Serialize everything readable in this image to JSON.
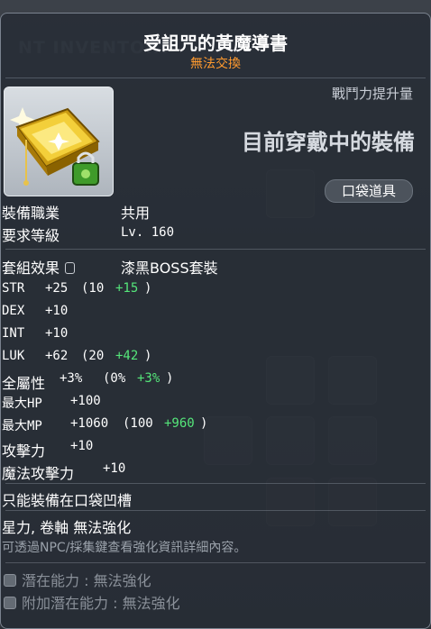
{
  "item": {
    "name": "受詛咒的黃魔導書",
    "trade_status": "無法交換"
  },
  "header": {
    "power_label": "戰鬥力提升量",
    "equipped_text": "目前穿戴中的裝備",
    "pocket_badge": "口袋道具"
  },
  "info": {
    "job_label": "裝備職業",
    "job_value": "共用",
    "level_label": "要求等級",
    "level_value": "Lv. 160",
    "set_label": "套組效果",
    "set_value": "漆黑BOSS套裝"
  },
  "stats": [
    {
      "name": "STR",
      "total": "+25",
      "base": "(10",
      "bonus": "+15",
      "close": ")"
    },
    {
      "name": "DEX",
      "total": "+10",
      "base": "",
      "bonus": "",
      "close": ""
    },
    {
      "name": "INT",
      "total": "+10",
      "base": "",
      "bonus": "",
      "close": ""
    },
    {
      "name": "LUK",
      "total": "+62",
      "base": "(20",
      "bonus": "+42",
      "close": ")"
    },
    {
      "name": "全屬性",
      "total": "+3%",
      "base": "(0%",
      "bonus": "+3%",
      "close": ")"
    },
    {
      "name": "最大HP",
      "total": "+100",
      "base": "",
      "bonus": "",
      "close": ""
    },
    {
      "name": "最大MP",
      "total": "+1060",
      "base": "(100",
      "bonus": "+960",
      "close": ")"
    },
    {
      "name": "攻擊力",
      "total": "+10",
      "base": "",
      "bonus": "",
      "close": ""
    },
    {
      "name": "魔法攻擊力",
      "total": "+10",
      "base": "",
      "bonus": "",
      "close": ""
    }
  ],
  "notes": {
    "pocket_only": "只能裝備在口袋凹槽",
    "star_scroll": "星力, 卷軸 無法強化",
    "npc_info": "可透過NPC/採集鍵查看強化資訊詳細內容。"
  },
  "potential": {
    "potential_label": "潛在能力 : 無法強化",
    "additional_label": "附加潛在能力 : 無法強化"
  },
  "colors": {
    "trade_orange": "#ff9a2e",
    "bonus_green": "#55e67a"
  }
}
